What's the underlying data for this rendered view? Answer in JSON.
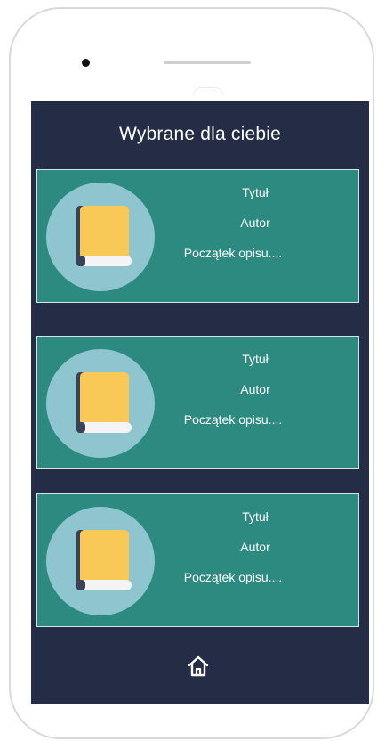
{
  "screen": {
    "title": "Wybrane dla ciebie"
  },
  "cards": [
    {
      "title": "Tytuł",
      "author": "Autor",
      "description": "Początek opisu...."
    },
    {
      "title": "Tytuł",
      "author": "Autor",
      "description": "Początek opisu...."
    },
    {
      "title": "Tytuł",
      "author": "Autor",
      "description": "Początek opisu...."
    }
  ],
  "nav": {
    "home_icon": "home-icon"
  },
  "colors": {
    "screen_bg": "#252c45",
    "card_bg": "#2c8a80",
    "circle_bg": "#8ec5cf",
    "book_cover": "#f8c957",
    "book_spine": "#3a4257",
    "text": "#ffffff"
  }
}
